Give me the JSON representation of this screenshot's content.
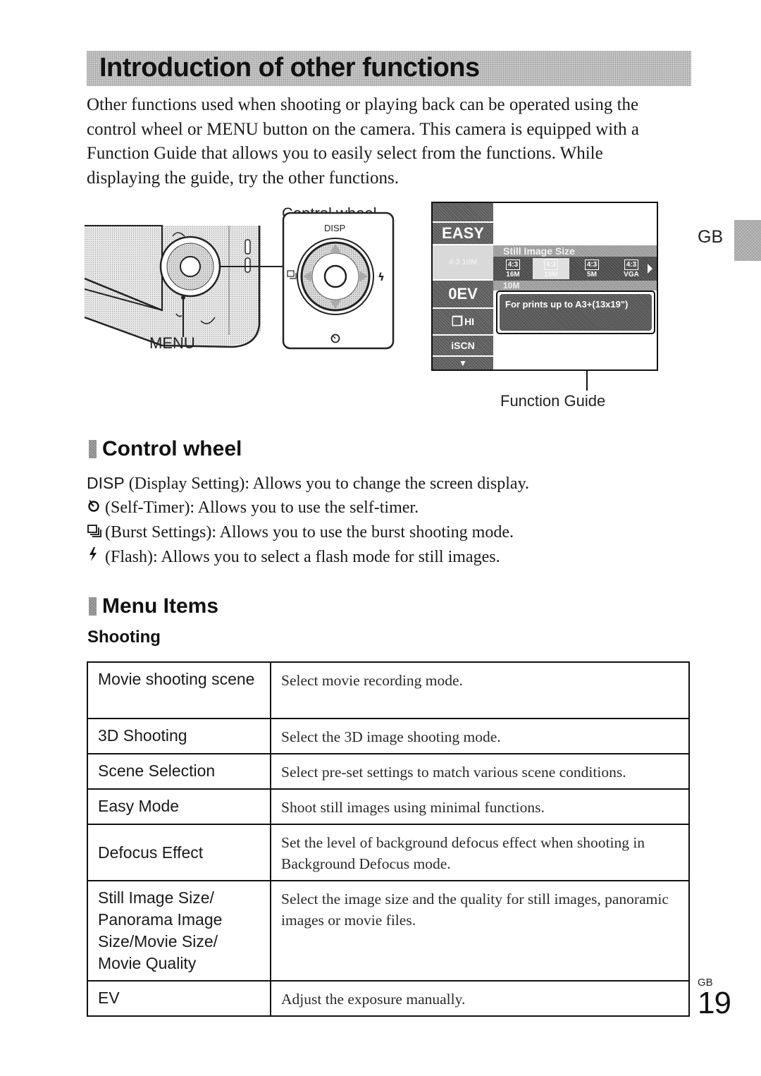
{
  "header": {
    "title": "Introduction of other functions"
  },
  "intro_paragraph": [
    "Other functions used when shooting or playing back can be operated using the",
    "control wheel or MENU button on the camera. This camera is equipped with a",
    "Function Guide that allows you to easily select from the functions. While",
    "displaying the guide, try the other functions."
  ],
  "side_marker": "GB",
  "figure_camera": {
    "control_wheel_label": "Control wheel",
    "menu_label": "MENU",
    "wheel_top_label": "DISP",
    "icons": [
      "burst-icon",
      "flash-icon",
      "self-timer-icon"
    ]
  },
  "figure_screen": {
    "left_menu": [
      {
        "label": "EASY",
        "icon": "easy-mode-icon",
        "selected": false
      },
      {
        "label": "4:3 10M",
        "icon": "image-size-icon",
        "selected": true
      },
      {
        "label": "0EV",
        "icon": "ev-icon",
        "selected": false
      },
      {
        "label": "HI",
        "icon": "burst-icon",
        "selected": false
      },
      {
        "label": "iSCN",
        "icon": "scene-icon",
        "selected": false
      },
      {
        "label": "▼",
        "icon": "scroll-down-icon",
        "selected": false
      }
    ],
    "panel_title": "Still Image Size",
    "size_options": [
      {
        "ratio": "4:3",
        "size": "16M",
        "selected": false
      },
      {
        "ratio": "4:3",
        "size": "10M",
        "selected": true
      },
      {
        "ratio": "4:3",
        "size": "5M",
        "selected": false
      },
      {
        "ratio": "4:3",
        "size": "VGA",
        "selected": false
      }
    ],
    "current_size": "10M",
    "guide_text": "For prints up to A3+(13x19\")",
    "function_guide_label": "Function Guide"
  },
  "control_wheel_section": {
    "heading": "Control wheel",
    "items": [
      {
        "key": "DISP",
        "icon": "",
        "text": "(Display Setting): Allows you to change the screen display."
      },
      {
        "key": "",
        "icon": "self-timer-icon",
        "text": "(Self-Timer): Allows you to use the self-timer."
      },
      {
        "key": "",
        "icon": "burst-icon",
        "text": "(Burst Settings): Allows you to use the burst shooting mode."
      },
      {
        "key": "",
        "icon": "flash-icon",
        "text": "(Flash): Allows you to select a flash mode for still images."
      }
    ]
  },
  "menu_items_section": {
    "heading": "Menu Items",
    "subheading": "Shooting",
    "rows": [
      {
        "item": "Movie shooting scene",
        "desc": "Select movie recording mode."
      },
      {
        "item": "3D Shooting",
        "desc": "Select the 3D image shooting mode."
      },
      {
        "item": "Scene Selection",
        "desc": "Select pre-set settings to match various scene conditions."
      },
      {
        "item": "Easy Mode",
        "desc": "Shoot still images using minimal functions."
      },
      {
        "item": "Defocus Effect",
        "desc": "Set the level of background defocus effect when shooting in Background Defocus mode."
      },
      {
        "item": "Still Image Size/ Panorama Image Size/Movie Size/ Movie Quality",
        "desc": "Select the image size and the quality for still images, panoramic images or movie files."
      },
      {
        "item": "EV",
        "desc": "Adjust the exposure manually."
      }
    ]
  },
  "footer": {
    "region": "GB",
    "page_number": "19"
  }
}
